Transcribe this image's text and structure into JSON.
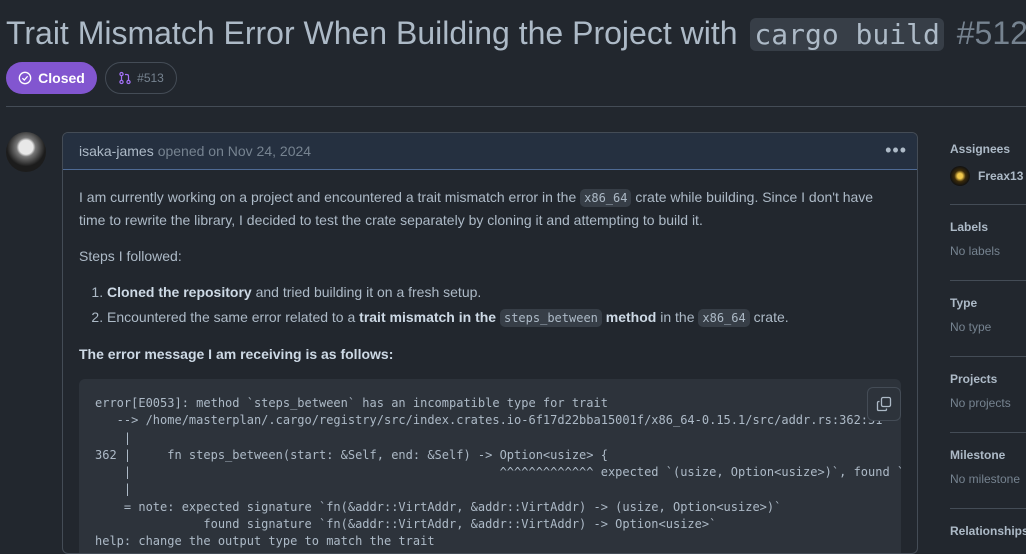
{
  "issue": {
    "title_text": "Trait Mismatch Error When Building the Project with",
    "title_code": "cargo build",
    "number": "#512",
    "state": "Closed",
    "linked_pr": "#513"
  },
  "comment": {
    "author": "isaka-james",
    "meta": "opened on Nov 24, 2024",
    "p1_a": "I am currently working on a project and encountered a trait mismatch error in the",
    "p1_code": "x86_64",
    "p1_b": "crate while building. Since I don't have time to rewrite the library, I decided to test the crate separately by cloning it and attempting to build it.",
    "p2": "Steps I followed:",
    "step1_bold": "Cloned the repository",
    "step1_rest": "and tried building it on a fresh setup.",
    "step2_a": "Encountered the same error related to a",
    "step2_bold1": "trait mismatch in the",
    "step2_code1": "steps_between",
    "step2_bold2": "method",
    "step2_b": "in the",
    "step2_code2": "x86_64",
    "step2_c": "crate.",
    "error_heading": "The error message I am receiving is as follows:",
    "code": "error[E0053]: method `steps_between` has an incompatible type for trait\n   --> /home/masterplan/.cargo/registry/src/index.crates.io-6f17d22bba15001f/x86_64-0.15.1/src/addr.rs:362:51\n    |\n362 |     fn steps_between(start: &Self, end: &Self) -> Option<usize> {\n    |                                                   ^^^^^^^^^^^^^ expected `(usize, Option<usize>)`, found `Option<usize>`\n    |\n    = note: expected signature `fn(&addr::VirtAddr, &addr::VirtAddr) -> (usize, Option<usize>)`\n               found signature `fn(&addr::VirtAddr, &addr::VirtAddr) -> Option<usize>`\nhelp: change the output type to match the trait"
  },
  "sidebar": {
    "assignees_label": "Assignees",
    "assignee_name": "Freax13",
    "labels_label": "Labels",
    "labels_value": "No labels",
    "type_label": "Type",
    "type_value": "No type",
    "projects_label": "Projects",
    "projects_value": "No projects",
    "milestone_label": "Milestone",
    "milestone_value": "No milestone",
    "relationships_label": "Relationships"
  },
  "colors": {
    "closed_purple": "#8256d0",
    "background": "#22272e",
    "header_highlight": "#253040"
  }
}
